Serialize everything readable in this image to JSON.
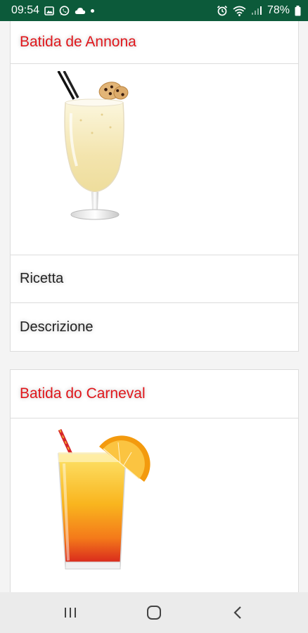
{
  "status_bar": {
    "time": "09:54",
    "battery": "78%",
    "icons": [
      "gallery-icon",
      "whatsapp-icon",
      "cloud-icon",
      "notification-dot-icon",
      "alarm-icon",
      "wifi-icon",
      "signal-icon",
      "battery-icon"
    ]
  },
  "cards": [
    {
      "title": "Batida de Annona",
      "image": "creamy-cocktail-image",
      "links": [
        "Ricetta",
        "Descrizione"
      ]
    },
    {
      "title": "Batida do Carneval",
      "image": "orange-cocktail-image"
    }
  ],
  "nav_bar": {
    "buttons": [
      "recent-apps",
      "home",
      "back"
    ]
  },
  "colors": {
    "status_bar": "#0c5a3a",
    "title": "#e0161b",
    "nav_bar": "#ebebeb"
  }
}
